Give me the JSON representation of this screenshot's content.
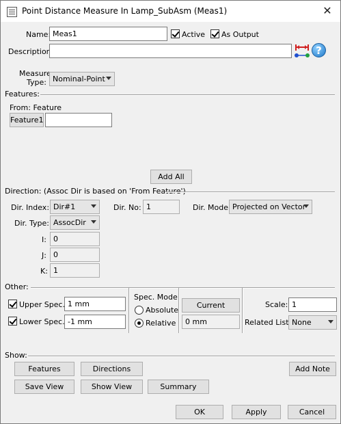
{
  "window": {
    "title": "Point Distance Measure In Lamp_SubAsm (Meas1)",
    "close_glyph": "✕"
  },
  "name": {
    "label": "Name:",
    "value": "Meas1"
  },
  "active": {
    "label": "Active",
    "checked": true
  },
  "as_output": {
    "label": "As Output",
    "checked": true
  },
  "description": {
    "label": "Description:",
    "value": ""
  },
  "measure_type": {
    "label_line1": "Measure",
    "label_line2": "Type:",
    "value": "Nominal-Point"
  },
  "features": {
    "section_label": "Features:",
    "from_label": "From: Feature",
    "feature_button": "Feature1",
    "feature_value": "",
    "add_all": "Add All"
  },
  "direction": {
    "section_label": "Direction: (Assoc Dir is based on 'From Feature')",
    "dir_index_label": "Dir. Index:",
    "dir_index_value": "Dir#1",
    "dir_no_label": "Dir. No:",
    "dir_no_value": "1",
    "dir_mode_label": "Dir. Mode:",
    "dir_mode_value": "Projected on Vector",
    "dir_type_label": "Dir. Type:",
    "dir_type_value": "AssocDir",
    "i_label": "I:",
    "i_value": "0",
    "j_label": "J:",
    "j_value": "0",
    "k_label": "K:",
    "k_value": "1"
  },
  "other": {
    "section_label": "Other:",
    "upper_spec_label": "Upper Spec.:",
    "upper_spec_value": "1 mm",
    "upper_checked": true,
    "lower_spec_label": "Lower Spec.:",
    "lower_spec_value": "-1 mm",
    "lower_checked": true,
    "spec_mode_label": "Spec. Mode:",
    "absolute_label": "Absolute",
    "relative_label": "Relative",
    "selected_mode": "Relative",
    "current_button": "Current",
    "current_value": "0 mm",
    "scale_label": "Scale:",
    "scale_value": "1",
    "related_list_label": "Related List:",
    "related_list_value": "None"
  },
  "show": {
    "section_label": "Show:",
    "features_button": "Features",
    "directions_button": "Directions",
    "add_note_button": "Add Note",
    "save_view_button": "Save View",
    "show_view_button": "Show View",
    "summary_button": "Summary"
  },
  "footer": {
    "ok": "OK",
    "apply": "Apply",
    "cancel": "Cancel"
  },
  "icons": {
    "measure_icon": "distance-measure-icon",
    "help_icon": "help-icon"
  },
  "colors": {
    "measure_icon_red": "#d02020",
    "measure_icon_blue": "#2050d0",
    "measure_icon_green": "#20a040"
  }
}
